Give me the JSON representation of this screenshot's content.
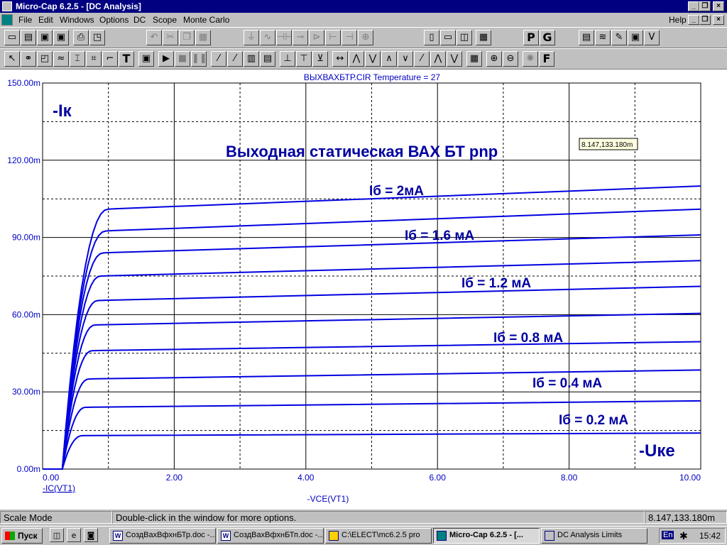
{
  "window": {
    "title": "Micro-Cap 6.2.5 - [DC Analysis]"
  },
  "menu": [
    "File",
    "Edit",
    "Windows",
    "Options",
    "DC",
    "Scope",
    "Monte Carlo"
  ],
  "menu_help": "Help",
  "plot": {
    "header": "ВЫХВАХБТР.CIR Temperature = 27",
    "title": "Выходная статическая ВАХ БТ pnp",
    "y_axis_label": "-Iк",
    "x_axis_label": "-Uке",
    "x_var": "-IC(VT1)",
    "x_expr": "-VCE(VT1)",
    "cursor_readout": "8.147,133.180m",
    "curve_labels": [
      "Iб = 2мА",
      "Iб = 1.6 мА",
      "Iб = 1.2 мА",
      "Iб = 0.8 мА",
      "Iб = 0.4 мА",
      "Iб = 0.2 мА"
    ]
  },
  "chart_data": {
    "type": "line",
    "xlim": [
      0,
      10
    ],
    "ylim": [
      0,
      150
    ],
    "x_ticks": [
      "0.00",
      "2.00",
      "4.00",
      "6.00",
      "8.00",
      "10.00"
    ],
    "y_ticks": [
      "0.00m",
      "30.00m",
      "60.00m",
      "90.00m",
      "120.00m",
      "150.00m"
    ],
    "grid": true,
    "x_axis_label": "-VCE(VT1)",
    "y_axis_label": "-IC(VT1)",
    "series": [
      {
        "sat": 13,
        "end": 14
      },
      {
        "sat": 24,
        "end": 26.5
      },
      {
        "sat": 35,
        "end": 38.5
      },
      {
        "sat": 46,
        "end": 49.5
      },
      {
        "sat": 56,
        "end": 60.5
      },
      {
        "sat": 65.5,
        "end": 71
      },
      {
        "sat": 75,
        "end": 81
      },
      {
        "sat": 84,
        "end": 91
      },
      {
        "sat": 92.5,
        "end": 101
      },
      {
        "sat": 101,
        "end": 110
      }
    ]
  },
  "status": {
    "mode": "Scale Mode",
    "hint": "Double-click in the window for more options.",
    "readout": "8.147,133.180m"
  },
  "taskbar": {
    "start": "Пуск",
    "tasks": [
      "СоздВахВфхнБТр.doc -...",
      "СоздВахВфхнБТп.doc -...",
      "C:\\ELECT\\mc6.2.5 pro",
      "Micro-Cap 6.2.5 - [...",
      "DC Analysis Limits"
    ],
    "lang": "En",
    "clock": "15:42"
  },
  "toolbar_letters": {
    "p": "P",
    "g": "G",
    "f": "F"
  }
}
